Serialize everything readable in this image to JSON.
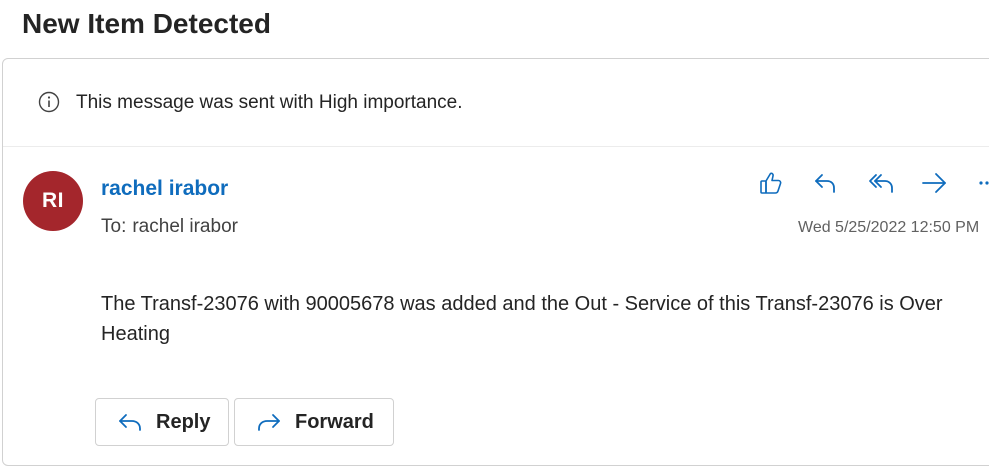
{
  "subject": "New Item Detected",
  "importance_notice": "This message was sent with High importance.",
  "sender": {
    "initials": "RI",
    "name": "rachel irabor",
    "avatar_color": "#a4262c"
  },
  "recipients": {
    "label": "To:",
    "name": "rachel irabor"
  },
  "timestamp": "Wed 5/25/2022 12:50 PM",
  "body": "The Transf-23076 with 90005678  was added and the Out - Service of this Transf-23076 is Over Heating",
  "actions": {
    "icons": [
      "like-icon",
      "reply-icon",
      "reply-all-icon",
      "forward-icon",
      "more-icon"
    ]
  },
  "buttons": {
    "reply_label": "Reply",
    "forward_label": "Forward"
  },
  "colors": {
    "accent": "#0f6cbd",
    "text": "#242424",
    "muted": "#616161"
  }
}
